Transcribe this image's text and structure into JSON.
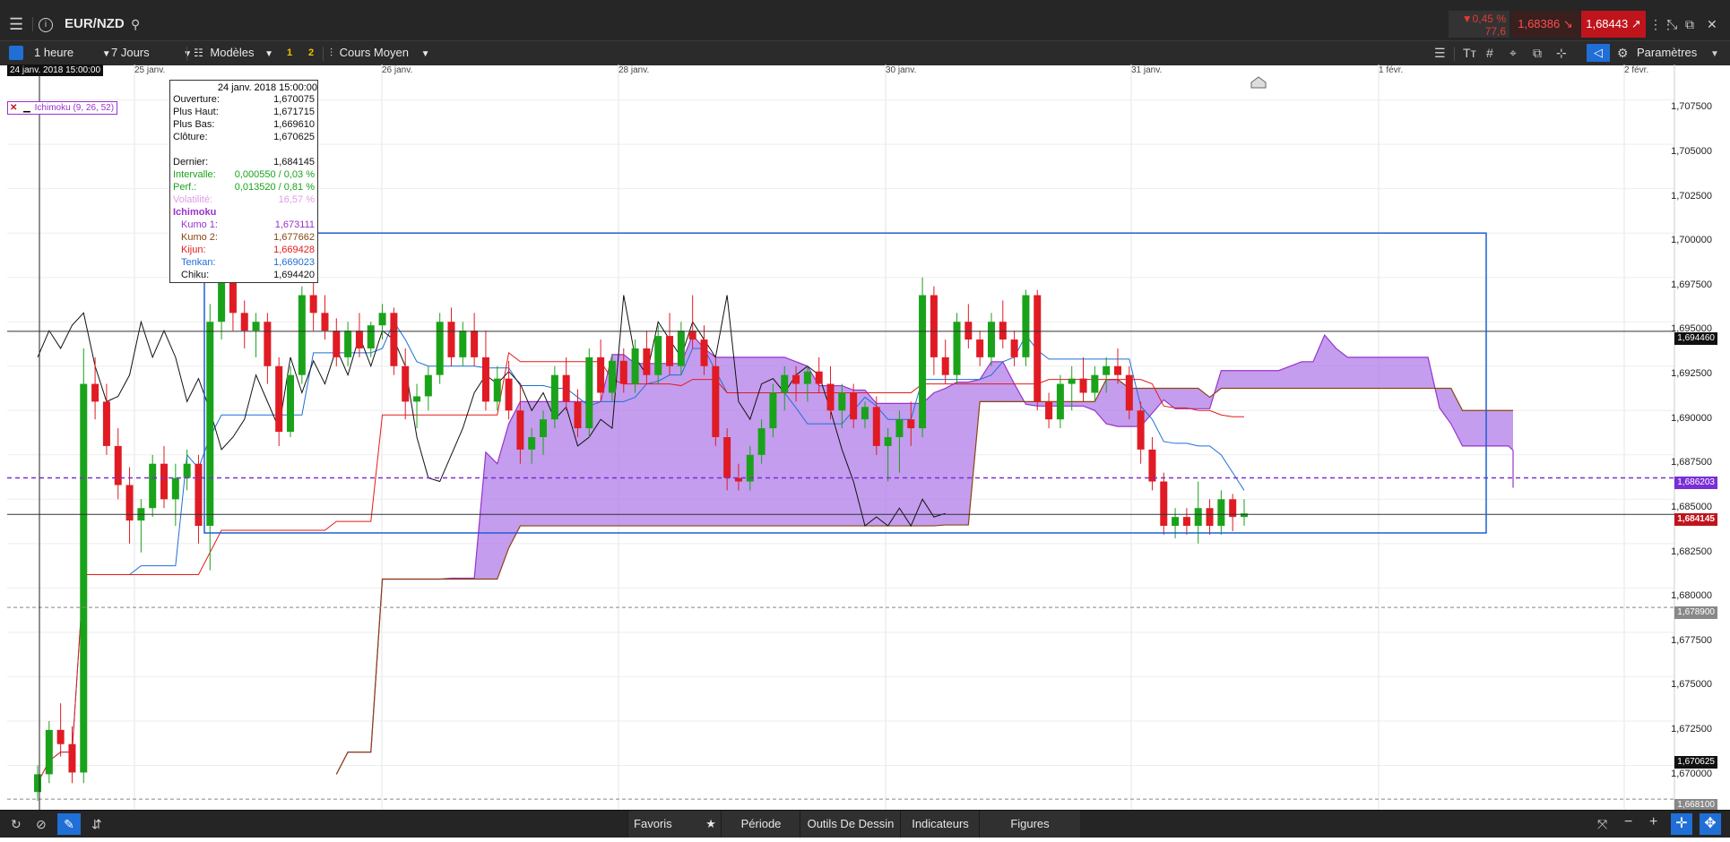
{
  "app": {
    "symbol": "EUR/NZD"
  },
  "topbar": {
    "change_pct": "▼0,45 %",
    "change_pts": "77,6",
    "sell_price": "1,68386",
    "buy_price": "1,68443"
  },
  "toolbar": {
    "interval": "1 heure",
    "range": "7 Jours",
    "models": "Modèles",
    "badge1": "1",
    "badge2": "2",
    "price_type": "Cours Moyen",
    "settings": "Paramètres"
  },
  "colors": {
    "up": "#1aa31a",
    "down": "#e01b24",
    "kumo1": "#9932cc",
    "kumo2": "#8b4513",
    "kijun": "#e31b1b",
    "tenkan": "#1f6fd6",
    "chiku": "#111111",
    "selection": "#1f5fd6"
  },
  "indicator_label": "Ichimoku (9, 26, 52)",
  "tooltip": {
    "date": "24 janv. 2018 15:00:00",
    "rows": [
      {
        "label": "Ouverture:",
        "value": "1,670075"
      },
      {
        "label": "Plus Haut:",
        "value": "1,671715"
      },
      {
        "label": "Plus Bas:",
        "value": "1,669610"
      },
      {
        "label": "Clôture:",
        "value": "1,670625"
      },
      {
        "label": "Dernier:",
        "value": "1,684145"
      },
      {
        "label": "Intervalle:",
        "value": "0,000550 / 0,03 %"
      },
      {
        "label": "Perf.:",
        "value": "0,013520 / 0,81 %"
      },
      {
        "label": "Volatilité:",
        "value": "16,57 %"
      },
      {
        "label": "Ichimoku",
        "value": ""
      },
      {
        "label": "Kumo 1:",
        "value": "1,673111"
      },
      {
        "label": "Kumo 2:",
        "value": "1,677662"
      },
      {
        "label": "Kijun:",
        "value": "1,669428"
      },
      {
        "label": "Tenkan:",
        "value": "1,669023"
      },
      {
        "label": "Chiku:",
        "value": "1,694420"
      }
    ]
  },
  "crosshair_date": "24 janv. 2018 15:00:00",
  "x_axis": [
    "25 janv.",
    "26 janv.",
    "28 janv.",
    "30 janv.",
    "31 janv.",
    "1 févr.",
    "2 févr."
  ],
  "y_axis": [
    "1,707500",
    "1,705000",
    "1,702500",
    "1,700000",
    "1,697500",
    "1,695000",
    "1,692500",
    "1,690000",
    "1,687500",
    "1,685000",
    "1,682500",
    "1,680000",
    "1,677500",
    "1,675000",
    "1,672500",
    "1,670000"
  ],
  "price_tags": {
    "chiku": "1,694460",
    "kumo": "1,686203",
    "last": "1,684145",
    "low_dash": "1,678900",
    "close": "1,670625",
    "bottom_dash": "1,668100"
  },
  "bottombar": {
    "favorites": "Favoris",
    "period": "Période",
    "drawing": "Outils De Dessin",
    "indicators": "Indicateurs",
    "figures": "Figures"
  },
  "chart_data": {
    "type": "candlestick",
    "symbol": "EUR/NZD",
    "interval": "1 heure",
    "ylim": [
      1.6675,
      1.7095
    ],
    "candles": [
      {
        "o": 1.6685,
        "h": 1.67,
        "l": 1.668,
        "c": 1.6695
      },
      {
        "o": 1.6695,
        "h": 1.6725,
        "l": 1.669,
        "c": 1.672
      },
      {
        "o": 1.672,
        "h": 1.6735,
        "l": 1.6705,
        "c": 1.6712
      },
      {
        "o": 1.6712,
        "h": 1.6722,
        "l": 1.669,
        "c": 1.6696
      },
      {
        "o": 1.6696,
        "h": 1.6935,
        "l": 1.669,
        "c": 1.6915
      },
      {
        "o": 1.6915,
        "h": 1.693,
        "l": 1.6895,
        "c": 1.6905
      },
      {
        "o": 1.6905,
        "h": 1.6915,
        "l": 1.6875,
        "c": 1.688
      },
      {
        "o": 1.688,
        "h": 1.689,
        "l": 1.685,
        "c": 1.6858
      },
      {
        "o": 1.6858,
        "h": 1.6868,
        "l": 1.6825,
        "c": 1.6838
      },
      {
        "o": 1.6838,
        "h": 1.685,
        "l": 1.682,
        "c": 1.6845
      },
      {
        "o": 1.6845,
        "h": 1.6875,
        "l": 1.684,
        "c": 1.687
      },
      {
        "o": 1.687,
        "h": 1.688,
        "l": 1.6845,
        "c": 1.685
      },
      {
        "o": 1.685,
        "h": 1.687,
        "l": 1.6835,
        "c": 1.6862
      },
      {
        "o": 1.6862,
        "h": 1.6878,
        "l": 1.6855,
        "c": 1.687
      },
      {
        "o": 1.687,
        "h": 1.6875,
        "l": 1.6825,
        "c": 1.6835
      },
      {
        "o": 1.6835,
        "h": 1.696,
        "l": 1.681,
        "c": 1.695
      },
      {
        "o": 1.695,
        "h": 1.6985,
        "l": 1.694,
        "c": 1.6975
      },
      {
        "o": 1.6975,
        "h": 1.698,
        "l": 1.6945,
        "c": 1.6955
      },
      {
        "o": 1.6955,
        "h": 1.6962,
        "l": 1.6935,
        "c": 1.6945
      },
      {
        "o": 1.6945,
        "h": 1.6955,
        "l": 1.693,
        "c": 1.695
      },
      {
        "o": 1.695,
        "h": 1.6955,
        "l": 1.6915,
        "c": 1.6925
      },
      {
        "o": 1.6925,
        "h": 1.693,
        "l": 1.688,
        "c": 1.6888
      },
      {
        "o": 1.6888,
        "h": 1.6925,
        "l": 1.6885,
        "c": 1.692
      },
      {
        "o": 1.692,
        "h": 1.697,
        "l": 1.6915,
        "c": 1.6965
      },
      {
        "o": 1.6965,
        "h": 1.6985,
        "l": 1.6945,
        "c": 1.6955
      },
      {
        "o": 1.6955,
        "h": 1.6965,
        "l": 1.694,
        "c": 1.6945
      },
      {
        "o": 1.6945,
        "h": 1.6952,
        "l": 1.6925,
        "c": 1.693
      },
      {
        "o": 1.693,
        "h": 1.695,
        "l": 1.6925,
        "c": 1.6945
      },
      {
        "o": 1.6945,
        "h": 1.6955,
        "l": 1.693,
        "c": 1.6935
      },
      {
        "o": 1.6935,
        "h": 1.695,
        "l": 1.693,
        "c": 1.6948
      },
      {
        "o": 1.6948,
        "h": 1.696,
        "l": 1.694,
        "c": 1.6955
      },
      {
        "o": 1.6955,
        "h": 1.6958,
        "l": 1.692,
        "c": 1.6925
      },
      {
        "o": 1.6925,
        "h": 1.6935,
        "l": 1.6895,
        "c": 1.6905
      },
      {
        "o": 1.6905,
        "h": 1.6915,
        "l": 1.689,
        "c": 1.6908
      },
      {
        "o": 1.6908,
        "h": 1.6925,
        "l": 1.69,
        "c": 1.692
      },
      {
        "o": 1.692,
        "h": 1.6955,
        "l": 1.6915,
        "c": 1.695
      },
      {
        "o": 1.695,
        "h": 1.6958,
        "l": 1.6925,
        "c": 1.693
      },
      {
        "o": 1.693,
        "h": 1.695,
        "l": 1.6925,
        "c": 1.6945
      },
      {
        "o": 1.6945,
        "h": 1.6955,
        "l": 1.6925,
        "c": 1.693
      },
      {
        "o": 1.693,
        "h": 1.6945,
        "l": 1.69,
        "c": 1.6905
      },
      {
        "o": 1.6905,
        "h": 1.6925,
        "l": 1.69,
        "c": 1.6918
      },
      {
        "o": 1.6918,
        "h": 1.6928,
        "l": 1.6895,
        "c": 1.69
      },
      {
        "o": 1.69,
        "h": 1.6915,
        "l": 1.687,
        "c": 1.6878
      },
      {
        "o": 1.6878,
        "h": 1.689,
        "l": 1.687,
        "c": 1.6885
      },
      {
        "o": 1.6885,
        "h": 1.69,
        "l": 1.6875,
        "c": 1.6895
      },
      {
        "o": 1.6895,
        "h": 1.6925,
        "l": 1.689,
        "c": 1.692
      },
      {
        "o": 1.692,
        "h": 1.693,
        "l": 1.69,
        "c": 1.6905
      },
      {
        "o": 1.6905,
        "h": 1.6912,
        "l": 1.6885,
        "c": 1.689
      },
      {
        "o": 1.689,
        "h": 1.6935,
        "l": 1.6885,
        "c": 1.693
      },
      {
        "o": 1.693,
        "h": 1.694,
        "l": 1.6905,
        "c": 1.691
      },
      {
        "o": 1.691,
        "h": 1.6932,
        "l": 1.6905,
        "c": 1.6928
      },
      {
        "o": 1.6928,
        "h": 1.6935,
        "l": 1.691,
        "c": 1.6915
      },
      {
        "o": 1.6915,
        "h": 1.694,
        "l": 1.691,
        "c": 1.6935
      },
      {
        "o": 1.6935,
        "h": 1.6945,
        "l": 1.6915,
        "c": 1.692
      },
      {
        "o": 1.692,
        "h": 1.6948,
        "l": 1.6915,
        "c": 1.6942
      },
      {
        "o": 1.6942,
        "h": 1.6955,
        "l": 1.692,
        "c": 1.6925
      },
      {
        "o": 1.6925,
        "h": 1.695,
        "l": 1.692,
        "c": 1.6945
      },
      {
        "o": 1.6945,
        "h": 1.6965,
        "l": 1.6935,
        "c": 1.694
      },
      {
        "o": 1.694,
        "h": 1.6948,
        "l": 1.692,
        "c": 1.6925
      },
      {
        "o": 1.6925,
        "h": 1.693,
        "l": 1.688,
        "c": 1.6885
      },
      {
        "o": 1.6885,
        "h": 1.689,
        "l": 1.6855,
        "c": 1.6862
      },
      {
        "o": 1.6862,
        "h": 1.687,
        "l": 1.6855,
        "c": 1.686
      },
      {
        "o": 1.686,
        "h": 1.688,
        "l": 1.6855,
        "c": 1.6875
      },
      {
        "o": 1.6875,
        "h": 1.6895,
        "l": 1.687,
        "c": 1.689
      },
      {
        "o": 1.689,
        "h": 1.6915,
        "l": 1.6885,
        "c": 1.691
      },
      {
        "o": 1.691,
        "h": 1.6925,
        "l": 1.69,
        "c": 1.692
      },
      {
        "o": 1.692,
        "h": 1.6925,
        "l": 1.6905,
        "c": 1.6915
      },
      {
        "o": 1.6915,
        "h": 1.6925,
        "l": 1.6905,
        "c": 1.6922
      },
      {
        "o": 1.6922,
        "h": 1.693,
        "l": 1.691,
        "c": 1.6915
      },
      {
        "o": 1.6915,
        "h": 1.6925,
        "l": 1.6895,
        "c": 1.69
      },
      {
        "o": 1.69,
        "h": 1.6915,
        "l": 1.689,
        "c": 1.691
      },
      {
        "o": 1.691,
        "h": 1.6915,
        "l": 1.689,
        "c": 1.6895
      },
      {
        "o": 1.6895,
        "h": 1.6905,
        "l": 1.689,
        "c": 1.6902
      },
      {
        "o": 1.6902,
        "h": 1.6908,
        "l": 1.6875,
        "c": 1.688
      },
      {
        "o": 1.688,
        "h": 1.689,
        "l": 1.686,
        "c": 1.6885
      },
      {
        "o": 1.6885,
        "h": 1.69,
        "l": 1.6865,
        "c": 1.6895
      },
      {
        "o": 1.6895,
        "h": 1.6905,
        "l": 1.688,
        "c": 1.689
      },
      {
        "o": 1.689,
        "h": 1.6975,
        "l": 1.6885,
        "c": 1.6965
      },
      {
        "o": 1.6965,
        "h": 1.697,
        "l": 1.692,
        "c": 1.693
      },
      {
        "o": 1.693,
        "h": 1.694,
        "l": 1.6915,
        "c": 1.692
      },
      {
        "o": 1.692,
        "h": 1.6955,
        "l": 1.6915,
        "c": 1.695
      },
      {
        "o": 1.695,
        "h": 1.696,
        "l": 1.6935,
        "c": 1.694
      },
      {
        "o": 1.694,
        "h": 1.6945,
        "l": 1.6925,
        "c": 1.693
      },
      {
        "o": 1.693,
        "h": 1.6955,
        "l": 1.6925,
        "c": 1.695
      },
      {
        "o": 1.695,
        "h": 1.6962,
        "l": 1.6935,
        "c": 1.694
      },
      {
        "o": 1.694,
        "h": 1.6945,
        "l": 1.6925,
        "c": 1.693
      },
      {
        "o": 1.693,
        "h": 1.6968,
        "l": 1.6925,
        "c": 1.6965
      },
      {
        "o": 1.6965,
        "h": 1.6968,
        "l": 1.69,
        "c": 1.6905
      },
      {
        "o": 1.6905,
        "h": 1.691,
        "l": 1.689,
        "c": 1.6895
      },
      {
        "o": 1.6895,
        "h": 1.692,
        "l": 1.689,
        "c": 1.6915
      },
      {
        "o": 1.6915,
        "h": 1.6925,
        "l": 1.69,
        "c": 1.6918
      },
      {
        "o": 1.6918,
        "h": 1.693,
        "l": 1.6905,
        "c": 1.691
      },
      {
        "o": 1.691,
        "h": 1.6925,
        "l": 1.6905,
        "c": 1.692
      },
      {
        "o": 1.692,
        "h": 1.693,
        "l": 1.691,
        "c": 1.6925
      },
      {
        "o": 1.6925,
        "h": 1.6935,
        "l": 1.6915,
        "c": 1.692
      },
      {
        "o": 1.692,
        "h": 1.6925,
        "l": 1.6895,
        "c": 1.69
      },
      {
        "o": 1.69,
        "h": 1.6905,
        "l": 1.687,
        "c": 1.6878
      },
      {
        "o": 1.6878,
        "h": 1.6885,
        "l": 1.6855,
        "c": 1.686
      },
      {
        "o": 1.686,
        "h": 1.6865,
        "l": 1.683,
        "c": 1.6835
      },
      {
        "o": 1.6835,
        "h": 1.6845,
        "l": 1.6828,
        "c": 1.684
      },
      {
        "o": 1.684,
        "h": 1.6845,
        "l": 1.683,
        "c": 1.6835
      },
      {
        "o": 1.6835,
        "h": 1.686,
        "l": 1.6825,
        "c": 1.6845
      },
      {
        "o": 1.6845,
        "h": 1.685,
        "l": 1.683,
        "c": 1.6835
      },
      {
        "o": 1.6835,
        "h": 1.6855,
        "l": 1.683,
        "c": 1.685
      },
      {
        "o": 1.685,
        "h": 1.6853,
        "l": 1.6832,
        "c": 1.684
      },
      {
        "o": 1.684,
        "h": 1.685,
        "l": 1.6835,
        "c": 1.6842
      }
    ],
    "ichimoku": {
      "tenkan": 9,
      "kijun": 26,
      "senkou": 52
    },
    "horizontal_lines": [
      1.69446,
      1.686203,
      1.684145,
      1.6789,
      1.6681
    ],
    "selection_box": {
      "y_top": 1.7,
      "y_bottom": 1.6831
    }
  }
}
